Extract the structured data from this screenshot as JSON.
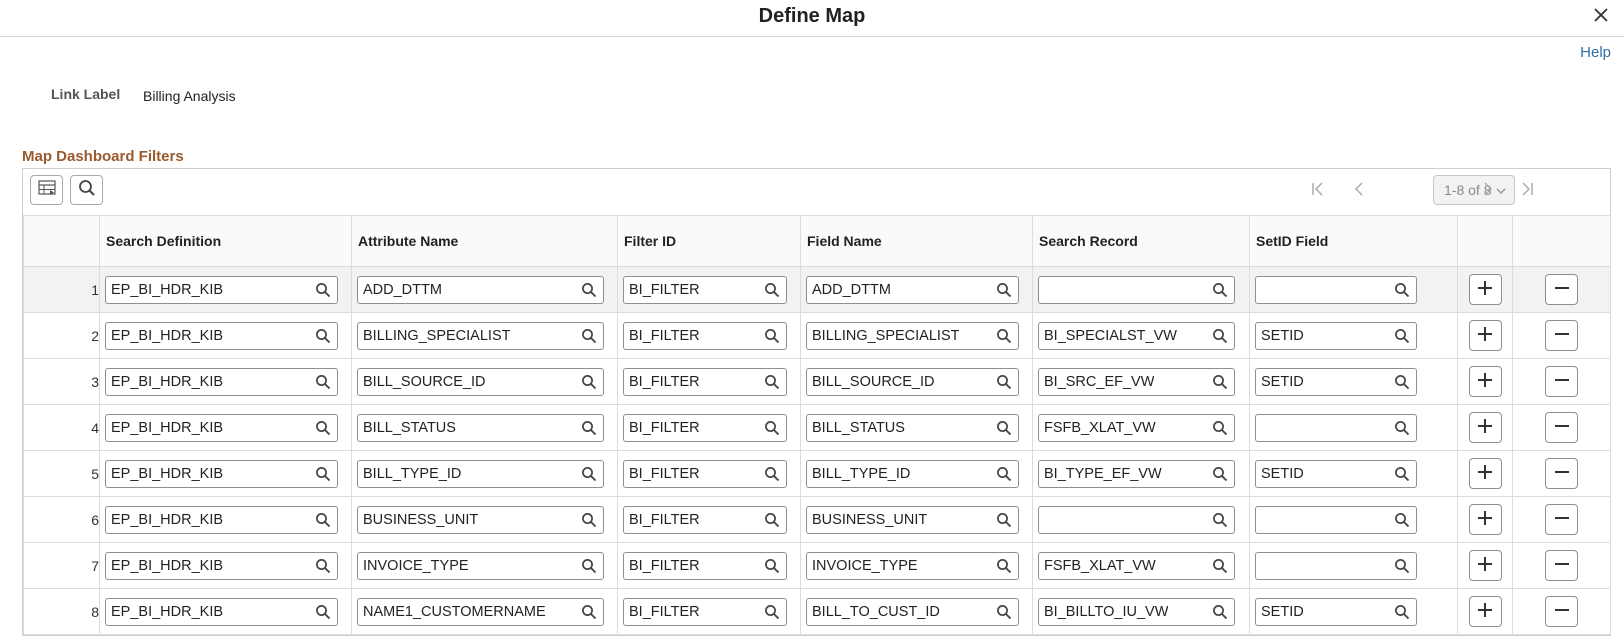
{
  "window": {
    "title": "Define Map",
    "help_label": "Help"
  },
  "link_label": {
    "label": "Link Label",
    "value": "Billing Analysis"
  },
  "section": {
    "title": "Map Dashboard Filters"
  },
  "grid": {
    "pager_text": "1-8 of 8",
    "columns": [
      "Search Definition",
      "Attribute Name",
      "Filter ID",
      "Field Name",
      "Search Record",
      "SetID Field"
    ],
    "rows": [
      {
        "num": "1",
        "search_definition": "EP_BI_HDR_KIB",
        "attribute_name": "ADD_DTTM",
        "filter_id": "BI_FILTER",
        "field_name": "ADD_DTTM",
        "search_record": "",
        "setid_field": ""
      },
      {
        "num": "2",
        "search_definition": "EP_BI_HDR_KIB",
        "attribute_name": "BILLING_SPECIALIST",
        "filter_id": "BI_FILTER",
        "field_name": "BILLING_SPECIALIST",
        "search_record": "BI_SPECIALST_VW",
        "setid_field": "SETID"
      },
      {
        "num": "3",
        "search_definition": "EP_BI_HDR_KIB",
        "attribute_name": "BILL_SOURCE_ID",
        "filter_id": "BI_FILTER",
        "field_name": "BILL_SOURCE_ID",
        "search_record": "BI_SRC_EF_VW",
        "setid_field": "SETID"
      },
      {
        "num": "4",
        "search_definition": "EP_BI_HDR_KIB",
        "attribute_name": "BILL_STATUS",
        "filter_id": "BI_FILTER",
        "field_name": "BILL_STATUS",
        "search_record": "FSFB_XLAT_VW",
        "setid_field": ""
      },
      {
        "num": "5",
        "search_definition": "EP_BI_HDR_KIB",
        "attribute_name": "BILL_TYPE_ID",
        "filter_id": "BI_FILTER",
        "field_name": "BILL_TYPE_ID",
        "search_record": "BI_TYPE_EF_VW",
        "setid_field": "SETID"
      },
      {
        "num": "6",
        "search_definition": "EP_BI_HDR_KIB",
        "attribute_name": "BUSINESS_UNIT",
        "filter_id": "BI_FILTER",
        "field_name": "BUSINESS_UNIT",
        "search_record": "",
        "setid_field": ""
      },
      {
        "num": "7",
        "search_definition": "EP_BI_HDR_KIB",
        "attribute_name": "INVOICE_TYPE",
        "filter_id": "BI_FILTER",
        "field_name": "INVOICE_TYPE",
        "search_record": "FSFB_XLAT_VW",
        "setid_field": ""
      },
      {
        "num": "8",
        "search_definition": "EP_BI_HDR_KIB",
        "attribute_name": "NAME1_CUSTOMERNAME",
        "filter_id": "BI_FILTER",
        "field_name": "BILL_TO_CUST_ID",
        "search_record": "BI_BILLTO_IU_VW",
        "setid_field": "SETID"
      }
    ]
  },
  "icons": {
    "close": "close-icon",
    "personalize": "grid-personalize-icon",
    "find": "search-icon",
    "first": "first-page-icon",
    "prev": "previous-page-icon",
    "next": "next-page-icon",
    "last": "last-page-icon",
    "lookup": "lookup-search-icon",
    "add": "plus-icon",
    "delete": "minus-icon"
  },
  "colors": {
    "section_title": "#9a5a2c",
    "help_link": "#2f6ea8",
    "first_row_bg": "#f2f2f2"
  }
}
